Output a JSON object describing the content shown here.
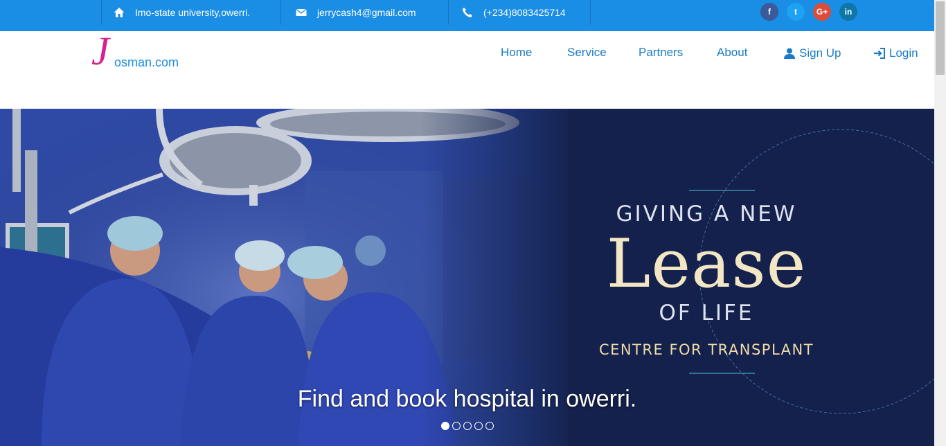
{
  "topbar": {
    "address": "Imo-state university,owerri.",
    "email": "jerrycash4@gmail.com",
    "phone": "(+234)8083425714",
    "social": [
      {
        "name": "facebook",
        "glyph": "f",
        "color": "#3b5a9a"
      },
      {
        "name": "twitter",
        "glyph": "t",
        "color": "#1da1f2"
      },
      {
        "name": "google-plus",
        "glyph": "G+",
        "color": "#dd4b39"
      },
      {
        "name": "linkedin",
        "glyph": "in",
        "color": "#0e76a8"
      }
    ]
  },
  "logo": {
    "initial": "J",
    "rest": "osman.com"
  },
  "nav": {
    "home": "Home",
    "service": "Service",
    "partners": "Partners",
    "about": "About",
    "signup": "Sign Up",
    "login": "Login"
  },
  "hero": {
    "line1": "GIVING A NEW",
    "big": "Lease",
    "line3": "OF LIFE",
    "line4": "CENTRE FOR TRANSPLANT",
    "caption": "Find and book hospital in owerri.",
    "slides_total": 5,
    "active_slide": 1
  },
  "colors": {
    "accent": "#1a8de4",
    "logo_pink": "#d6228f",
    "nav_text": "#1a7ac7"
  }
}
